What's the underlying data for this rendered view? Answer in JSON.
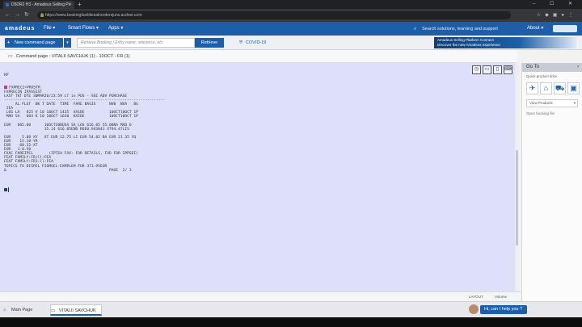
{
  "browser": {
    "tab_title": "D5DR2 H3 - Amadeus Selling Pl",
    "new_tab": "+",
    "url": "https://www.bookingfacilitiesalnordersjuns.acdoer.com",
    "window_controls": "–  ☐  ✕"
  },
  "app": {
    "logo": "amadeus",
    "menu": [
      "File",
      "Smart Flows",
      "Apps"
    ],
    "search_placeholder": "Search solutions, learning and support",
    "about": "About"
  },
  "toolbar": {
    "new_command": "New command page",
    "retrieve_placeholder": "Retrieve Booking / Entry name, reference, etc.",
    "retrieve_button": "Retrieve",
    "covid": "COVID-19",
    "banner_line1": "Amadeus Selling Platform Connect",
    "banner_line2": "Discover the new Amadeus experience"
  },
  "command_page": {
    "title": "Command page : VITALII SAVCHUK (1) - 10OCT - FR (1)"
  },
  "terminal": {
    "lines": [
      "RP",
      "",
      "",
      "FXPRECI+PRXSTR",
      "FXPRECIN IPASSIST",
      "LAST TKT DTE 30MAR20/23:59 LT in POS - SEE ADV PURCHASE",
      "------------------------------------------------------------------------",
      "     AL FLGT  BK T DATE  TIME  FARE BASIS      NVB  NVA   BG",
      " IEA",
      " LOS LA   825 V 10 10OCT 1435  VA1DE           10OCT10OCT 1P",
      " MAD SA   604 K 10 10OCT 1630  KAIDE           10OCT10OCT 1P",
      "",
      "EUR   605.00      10OCT20BUSA SA LOS 616.05 55.00NA MAD 0",
      "                  15.14 616.05END ROE0.943043 XT94.47LIS",
      "",
      "EUR     5.00 XY   XT EUR 12.75 LI EUR 54.82 BA EUR 21.35 YQ",
      "EUR    15.18-YR",
      "EUR    60.32-XT",
      "EUR   1-0.50",
      "FXAC FAREIPCL       (IPTEA FAX: FOR DETAILS, FXD FOR IPPSEI)",
      "FEAT FAMILY:FR)ll:FEA",
      "FEAT FAMILY:FR1:ll:FEA",
      "TOPICS TO DISPEL FIOMGEL-EXMPLEM FOR 373.95EUR",
      "&                                              PAGE  2/ 3"
    ],
    "tool_icons": [
      "history-icon",
      "minimize-icon",
      "split-icon",
      "keyboard-icon"
    ]
  },
  "status": {
    "left": "",
    "right_a": "LAYOUT",
    "right_b": "Volume"
  },
  "right_panel": {
    "title": "Go To",
    "subtitle": "Quick product links",
    "icons": [
      "flight-icon",
      "hotel-icon",
      "car-icon",
      "train-icon"
    ],
    "select_value": "View Products",
    "link": "Open booking file"
  },
  "sessions": {
    "main": "Main Page",
    "active": "VITALII SAVCHUK",
    "help": "Hi, can I help you ?"
  }
}
